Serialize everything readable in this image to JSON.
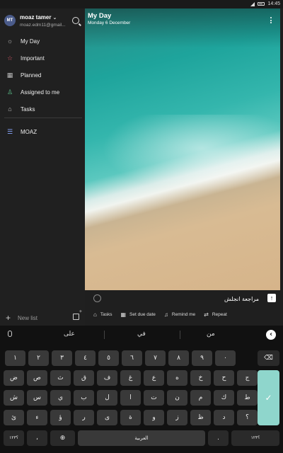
{
  "status_bar": {
    "time": "14:45"
  },
  "sidebar": {
    "user_name": "moaz tamer",
    "user_email": "moaz.edm11@gmail...",
    "avatar_initials": "MT",
    "items": [
      {
        "label": "My Day",
        "icon": "sun-icon"
      },
      {
        "label": "Important",
        "icon": "star-icon",
        "color": "#e05a6b"
      },
      {
        "label": "Planned",
        "icon": "calendar-icon"
      },
      {
        "label": "Assigned to me",
        "icon": "person-icon",
        "color": "#5bbf8a"
      },
      {
        "label": "Tasks",
        "icon": "home-icon"
      }
    ],
    "lists": [
      {
        "label": "MOAZ",
        "icon": "list-icon"
      }
    ],
    "new_list_label": "New list"
  },
  "main": {
    "title": "My Day",
    "subtitle": "Monday 6 December",
    "task_input_value": "مراجعة انجلش",
    "options": [
      {
        "label": "Tasks",
        "icon": "home-icon"
      },
      {
        "label": "Set due date",
        "icon": "calendar-icon"
      },
      {
        "label": "Remind me",
        "icon": "bell-icon"
      },
      {
        "label": "Repeat",
        "icon": "repeat-icon"
      }
    ]
  },
  "keyboard": {
    "suggestions": [
      "على",
      "في",
      "من"
    ],
    "row1": [
      "١",
      "٢",
      "٣",
      "٤",
      "٥",
      "٦",
      "٧",
      "٨",
      "٩",
      "٠"
    ],
    "row2": [
      "ض",
      "ص",
      "ث",
      "ق",
      "ف",
      "غ",
      "ع",
      "ه",
      "خ",
      "ح",
      "ج"
    ],
    "row3": [
      "ش",
      "س",
      "ي",
      "ب",
      "ل",
      "ا",
      "ت",
      "ن",
      "م",
      "ك",
      "ط"
    ],
    "row4": [
      "ئ",
      "ء",
      "ؤ",
      "ر",
      "ى",
      "ة",
      "و",
      "ز",
      "ظ",
      "د",
      "؟"
    ],
    "symbols_key": "؟١٢٣",
    "comma_key": "،",
    "space_label": "العربية",
    "period_key": ".",
    "accent_color": "#8fd6cc"
  }
}
